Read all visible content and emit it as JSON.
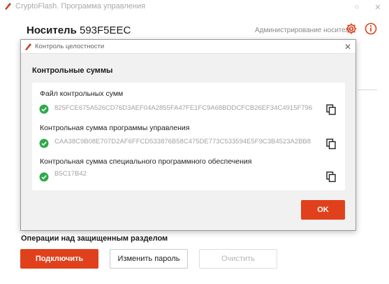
{
  "window": {
    "title": "CryptoFlash. Программа управления"
  },
  "header": {
    "label": "Носитель",
    "serial": "593F5EEC",
    "admin_link": "Администрирование носителя"
  },
  "operations": {
    "title": "Операции над защищенным разделом",
    "connect_label": "Подключить",
    "change_password_label": "Изменить пароль",
    "clear_label": "Очистить"
  },
  "dialog": {
    "title": "Контроль целостности",
    "section_title": "Контрольные суммы",
    "rows": [
      {
        "label": "Файл контрольных сумм",
        "value": "825FCE675A526CD76D3AEF04A2855FA47FE1FC9A68BDDCFCB26EF34C4915F796",
        "status": "ok"
      },
      {
        "label": "Контрольная сумма программы управления",
        "value": "CAA38C9B08E707D2AF6FFCD533876B58C475DE773C533594E5F9C3B4523A2BB8",
        "status": "ok"
      },
      {
        "label": "Контрольная сумма специального программного обеспечения",
        "value": "B5C17B42",
        "status": "ok"
      }
    ],
    "ok_label": "OK"
  },
  "colors": {
    "accent": "#e0411c",
    "success": "#2eaa4a"
  }
}
